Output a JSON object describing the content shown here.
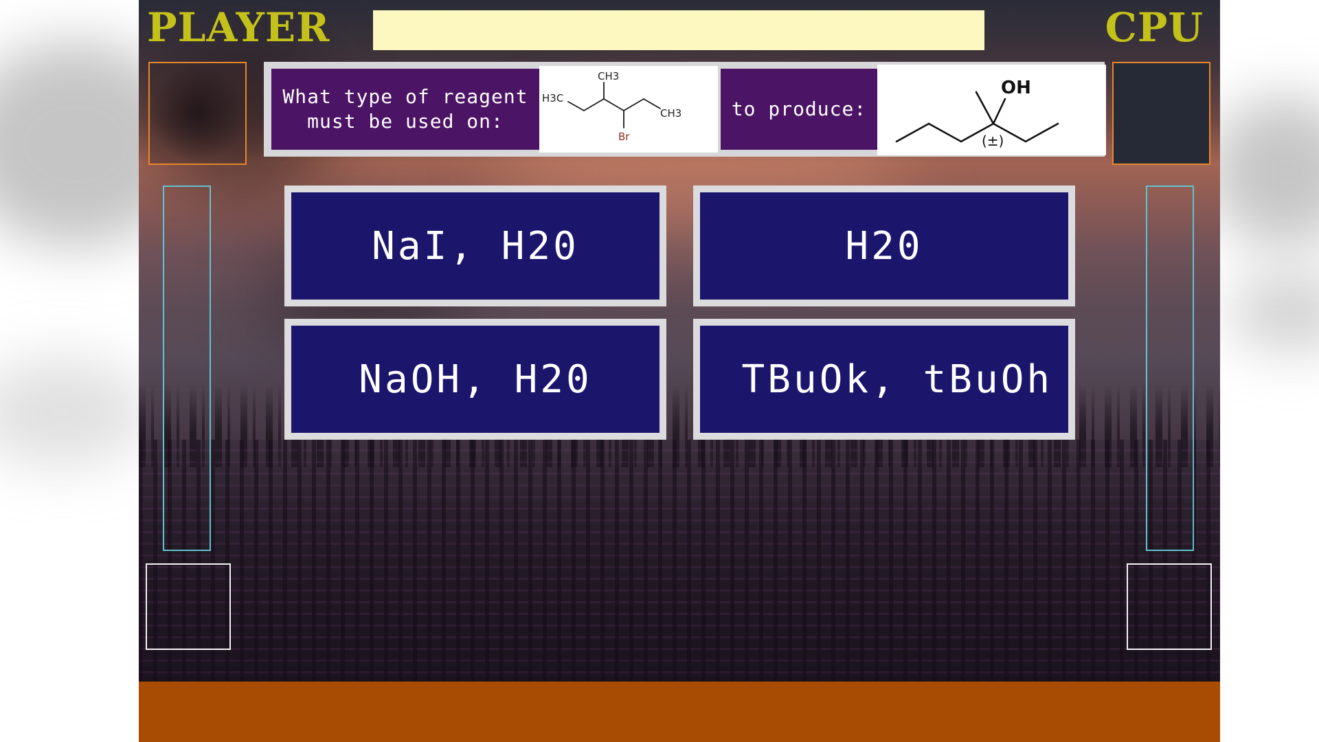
{
  "scoreboard": {
    "player_label": "PLAYER",
    "cpu_label": "CPU"
  },
  "status_bar": {
    "text": ""
  },
  "question": {
    "prefix": "What type of reagent\nmust be used on:",
    "suffix": "to produce:",
    "reactant": {
      "atom_labels": [
        "CH3",
        "H3C",
        "CH3",
        "Br"
      ]
    },
    "product": {
      "atom_labels": [
        "OH",
        "(±)"
      ]
    }
  },
  "answers": [
    {
      "label": "NaI, H20"
    },
    {
      "label": "H20"
    },
    {
      "label": "NaOH, H20"
    },
    {
      "label": " TBuOk, tBuOh"
    }
  ],
  "colors": {
    "label_yellow": "#c4c21a",
    "status_bar": "#fcf8c0",
    "question_purple": "#4b1465",
    "answer_navy": "#1b166c",
    "answer_border": "#dcdcdf",
    "avatar_frame": "#e8862a",
    "health_frame": "#62c3d0",
    "bottom_bar": "#a84c04"
  }
}
